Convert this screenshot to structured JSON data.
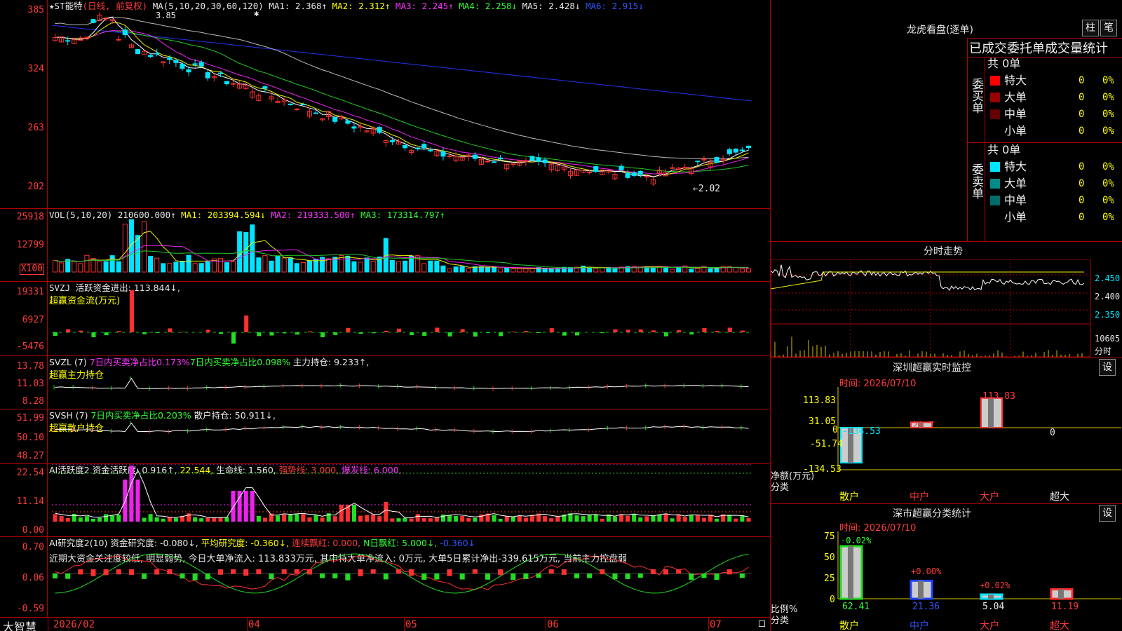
{
  "app": {
    "brand": "大智慧"
  },
  "main": {
    "title": "★ST能特",
    "period": "(日线, 前复权)",
    "ma_label": "MA(5,10,20,30,60,120)",
    "ma1": "MA1: 2.368↑",
    "ma2": "MA2: 2.312↑",
    "ma3": "MA3: 2.245↑",
    "ma4": "MA4: 2.258↓",
    "ma5": "MA5: 2.428↓",
    "ma6": "MA6: 2.915↓",
    "high_mark": "3.85",
    "low_mark": "←2.02",
    "yticks": [
      "385",
      "324",
      "263",
      "202"
    ],
    "star": "✱"
  },
  "vol": {
    "label": "VOL(5,10,20)",
    "value": "210600.000↑",
    "ma1": "MA1: 203394.594↓",
    "ma2": "MA2: 219333.500↑",
    "ma3": "MA3: 173314.797↑",
    "yticks": [
      "25918",
      "12799"
    ],
    "unit": "X100"
  },
  "svzj": {
    "label": "SVZJ",
    "value": "活跃资金进出: 113.844↓,",
    "sub": "超赢资金流(万元)",
    "yticks": [
      "19331",
      "6927",
      "-5476"
    ]
  },
  "svzl": {
    "label": "SVZL (7)",
    "a": "7日内买卖净占比0.173%",
    "b": "7日内买卖净占比0.098%",
    "c": "主力持仓: 9.233↑,",
    "sub": "超赢主力持仓",
    "yticks": [
      "13.78",
      "11.03",
      "8.28"
    ]
  },
  "svsh": {
    "label": "SVSH (7)",
    "a": "7日内买卖净占比0.203%",
    "c": "散户持仓: 50.911↓,",
    "sub": "超赢散户持仓",
    "yticks": [
      "51.99",
      "50.10",
      "48.27"
    ]
  },
  "ai1": {
    "label": "AI活跃度2",
    "a": "资金活跃度: 0.916↑,",
    "b": "22.544,",
    "c": "生命线: 1.560,",
    "d": "强势线: 3.000,",
    "e": "爆发线: 6.000,",
    "yticks": [
      "22.54",
      "11.14",
      "0.00"
    ]
  },
  "ai2": {
    "label": "AI研究度2(10)",
    "a": "资金研究度: -0.080↓,",
    "b": "平均研究度: -0.360↓,",
    "c": "连续飘红: 0.000,",
    "d": "N日飘红: 5.000↓,",
    "e": "-0.360↓",
    "note": "近期大资金关注度较低, 明显弱势, 今日大单净流入: 113.833万元, 其中特大单净流入: 0万元, 大单5日累计净出-339.615万元, 当前主力控盘弱",
    "yticks": [
      "0.70",
      "0.06",
      "-0.59"
    ]
  },
  "xaxis": [
    "2026/02",
    "04",
    "05",
    "06",
    "07"
  ],
  "lhb": {
    "title": "龙虎看盘(逐单)",
    "btn_bar": "柱",
    "btn_tick": "笔",
    "header": "已成交委托单成交量统计",
    "buy_label": "委买单",
    "sell_label": "委卖单",
    "buy_total": "共 0单",
    "sell_total": "共 0单",
    "buy_rows": [
      {
        "name": "特大",
        "n": "0",
        "p": "0%",
        "color": "#ff0000"
      },
      {
        "name": "大单",
        "n": "0",
        "p": "0%",
        "color": "#990000"
      },
      {
        "name": "中单",
        "n": "0",
        "p": "0%",
        "color": "#660000"
      },
      {
        "name": "小单",
        "n": "0",
        "p": "0%",
        "color": "#000000"
      }
    ],
    "sell_rows": [
      {
        "name": "特大",
        "n": "0",
        "p": "0%",
        "color": "#00e5ff"
      },
      {
        "name": "大单",
        "n": "0",
        "p": "0%",
        "color": "#008a8a"
      },
      {
        "name": "中单",
        "n": "0",
        "p": "0%",
        "color": "#006b6b"
      },
      {
        "name": "小单",
        "n": "0",
        "p": "0%",
        "color": "#000000"
      }
    ]
  },
  "fenshi": {
    "title": "分时走势",
    "yticks": [
      "2.450",
      "2.400",
      "2.350"
    ],
    "vol_tick": "10605",
    "vol_label": "分时"
  },
  "monitor": {
    "title": "深圳超赢实时监控",
    "btn": "设",
    "time": "时间: 2026/07/10",
    "yticks": [
      "113.83",
      "31.05",
      "0",
      "-51.74",
      "-134.53"
    ],
    "ylabel": "净额(万元)",
    "xlabel": "分类",
    "cats": [
      "散户",
      "中户",
      "大户",
      "超大"
    ],
    "values": [
      "-134.53",
      "20.7",
      "113.83",
      "0"
    ]
  },
  "classify": {
    "title": "深市超赢分类统计",
    "btn": "设",
    "time": "时间: 2026/07/10",
    "yticks": [
      "75",
      "50",
      "25",
      "0"
    ],
    "ylabel": "比例%",
    "xlabel": "分类",
    "cats": [
      "散户",
      "中户",
      "大户",
      "超大"
    ],
    "values": [
      "62.41",
      "21.36",
      "5.04",
      "11.19"
    ],
    "changes": [
      "-0.02%",
      "+0.00%",
      "+0.02%",
      ""
    ]
  }
}
